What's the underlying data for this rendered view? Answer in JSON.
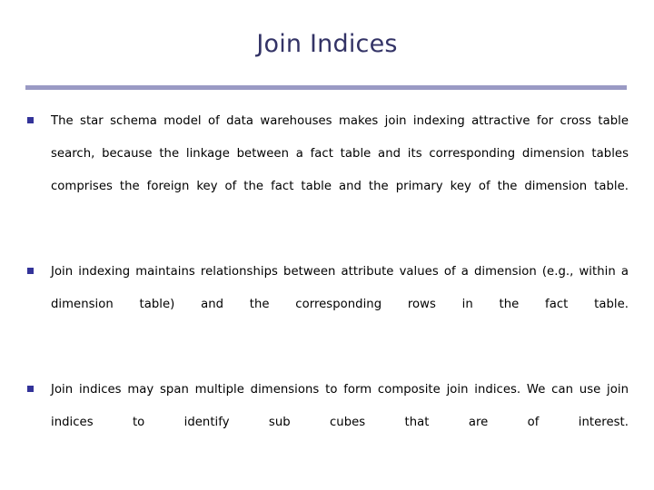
{
  "slide": {
    "title": "Join Indices",
    "accent_color": "#333366",
    "rule_color": "#9a9ac4",
    "bullet_color": "#333399",
    "body_color": "#000000",
    "background_color": "#ffffff",
    "bullets": [
      {
        "marker": "square-bullet",
        "text": "The star schema model of data warehouses makes join indexing attractive for cross table search, because the linkage between a fact table and its corresponding dimension tables comprises the foreign key of the fact table and the primary key of the dimension table."
      },
      {
        "marker": "square-bullet",
        "text": "Join indexing maintains relationships between attribute values of a dimension (e.g., within a dimension table) and the corresponding rows in the fact table."
      },
      {
        "marker": "square-bullet",
        "text": "Join indices may span multiple dimensions to form composite join indices. We can use join indices to identify sub cubes that are of interest."
      }
    ]
  }
}
